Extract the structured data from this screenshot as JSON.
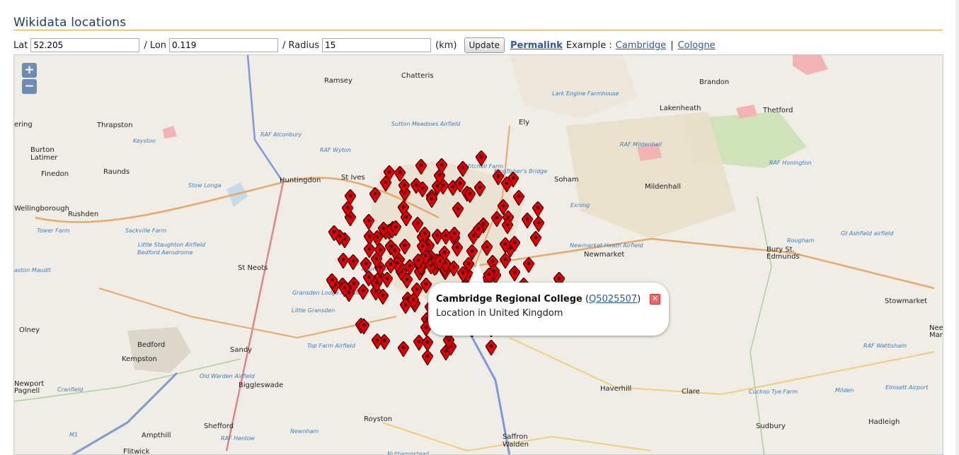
{
  "header": {
    "title": "Wikidata locations"
  },
  "form": {
    "lat_label": "Lat",
    "lat_value": "52.205",
    "lon_label": "/ Lon",
    "lon_value": "0.119",
    "radius_label": "/ Radius",
    "radius_value": "15",
    "unit_label": "(km)",
    "update_label": "Update",
    "permalink_label": "Permalink",
    "example_label": "Example :",
    "example_links": [
      "Cambridge",
      "Cologne"
    ],
    "separator": "|"
  },
  "map": {
    "zoom_in": "+",
    "zoom_out": "−",
    "places": [
      {
        "name": "Chatteris",
        "cls": "town"
      },
      {
        "name": "Ramsey",
        "cls": "town"
      },
      {
        "name": "Ely",
        "cls": "town"
      },
      {
        "name": "Brandon",
        "cls": "town"
      },
      {
        "name": "Lakenheath",
        "cls": "town"
      },
      {
        "name": "Thetford",
        "cls": "town"
      },
      {
        "name": "Thrapston",
        "cls": "town"
      },
      {
        "name": "Burton",
        "cls": "town"
      },
      {
        "name": "Latimer",
        "cls": "town"
      },
      {
        "name": "Finedon",
        "cls": "town"
      },
      {
        "name": "Raunds",
        "cls": "town"
      },
      {
        "name": "Huntingdon",
        "cls": "town"
      },
      {
        "name": "St Ives",
        "cls": "town"
      },
      {
        "name": "Soham",
        "cls": "town"
      },
      {
        "name": "Mildenhall",
        "cls": "town"
      },
      {
        "name": "Wellingborough",
        "cls": "town"
      },
      {
        "name": "Rushden",
        "cls": "town"
      },
      {
        "name": "St Neots",
        "cls": "town"
      },
      {
        "name": "Newmarket",
        "cls": "town"
      },
      {
        "name": "Bury St.",
        "cls": "town"
      },
      {
        "name": "Edmunds",
        "cls": "town"
      },
      {
        "name": "Olney",
        "cls": "town"
      },
      {
        "name": "Bedford",
        "cls": "town"
      },
      {
        "name": "Kempston",
        "cls": "town"
      },
      {
        "name": "Sandy",
        "cls": "town"
      },
      {
        "name": "Biggleswade",
        "cls": "town"
      },
      {
        "name": "Haverhill",
        "cls": "town"
      },
      {
        "name": "Clare",
        "cls": "town"
      },
      {
        "name": "Stowmarket",
        "cls": "town"
      },
      {
        "name": "Needham",
        "cls": "town"
      },
      {
        "name": "Market",
        "cls": "town"
      },
      {
        "name": "Royston",
        "cls": "town"
      },
      {
        "name": "Saffron",
        "cls": "town"
      },
      {
        "name": "Walden",
        "cls": "town"
      },
      {
        "name": "Sudbury",
        "cls": "town"
      },
      {
        "name": "Hadleigh",
        "cls": "town"
      },
      {
        "name": "Shefford",
        "cls": "town"
      },
      {
        "name": "Ampthill",
        "cls": "town"
      },
      {
        "name": "Flitwick",
        "cls": "town"
      },
      {
        "name": "ering",
        "cls": "town"
      },
      {
        "name": "Newport",
        "cls": "town"
      },
      {
        "name": "Pagnell",
        "cls": "town"
      },
      {
        "name": "Keyston",
        "cls": "air"
      },
      {
        "name": "RAF Alconbury",
        "cls": "air"
      },
      {
        "name": "RAF Wyton",
        "cls": "air"
      },
      {
        "name": "Stow Longa",
        "cls": "air"
      },
      {
        "name": "Sutton Meadows Airfield",
        "cls": "air"
      },
      {
        "name": "Lark Engine Farmhouse",
        "cls": "air"
      },
      {
        "name": "RAF Mildenhall",
        "cls": "air"
      },
      {
        "name": "RAF Honington",
        "cls": "air"
      },
      {
        "name": "Kingfisher's Bridge",
        "cls": "air"
      },
      {
        "name": "Mitchell Farm",
        "cls": "air"
      },
      {
        "name": "Exning",
        "cls": "air"
      },
      {
        "name": "Newmarket Heath Airfield",
        "cls": "air"
      },
      {
        "name": "Gt Ashfield airfield",
        "cls": "air"
      },
      {
        "name": "Rougham",
        "cls": "air"
      },
      {
        "name": "Tower Farm",
        "cls": "air"
      },
      {
        "name": "Sackville Farm",
        "cls": "air"
      },
      {
        "name": "Little Staughton Airfield",
        "cls": "air"
      },
      {
        "name": "Bedford Aerodrome",
        "cls": "air"
      },
      {
        "name": "aston Maudit",
        "cls": "air"
      },
      {
        "name": "Gransden Lodge Airfield",
        "cls": "air"
      },
      {
        "name": "Little Gransden",
        "cls": "air"
      },
      {
        "name": "Top Farm Airfield",
        "cls": "air"
      },
      {
        "name": "Old Warden Airfield",
        "cls": "air"
      },
      {
        "name": "Cranfield",
        "cls": "air"
      },
      {
        "name": "RAF Henlow",
        "cls": "air"
      },
      {
        "name": "Newnham",
        "cls": "air"
      },
      {
        "name": "Nuthampstead",
        "cls": "air"
      },
      {
        "name": "Cuckoo Tye Farm",
        "cls": "air"
      },
      {
        "name": "Milden",
        "cls": "air"
      },
      {
        "name": "Elmsett Airport",
        "cls": "air"
      },
      {
        "name": "RAF Wattisham",
        "cls": "air"
      },
      {
        "name": "Bourn Airfield",
        "cls": "air"
      },
      {
        "name": "M1",
        "cls": "air"
      }
    ]
  },
  "popup": {
    "title": "Cambridge Regional College",
    "qid_open": "(",
    "qid": "Q5025507",
    "qid_close": ")",
    "description": "Location in United Kingdom",
    "close_label": "✕"
  }
}
